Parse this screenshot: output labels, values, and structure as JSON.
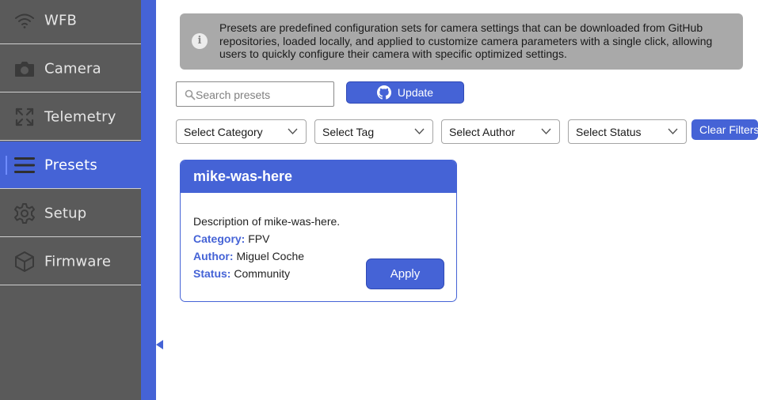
{
  "sidebar": {
    "items": [
      {
        "label": "WFB",
        "icon": "wifi-icon",
        "active": false
      },
      {
        "label": "Camera",
        "icon": "camera-icon",
        "active": false
      },
      {
        "label": "Telemetry",
        "icon": "expand-arrows-icon",
        "active": false
      },
      {
        "label": "Presets",
        "icon": "menu-lines-icon",
        "active": true
      },
      {
        "label": "Setup",
        "icon": "gear-icon",
        "active": false
      },
      {
        "label": "Firmware",
        "icon": "cube-icon",
        "active": false
      }
    ]
  },
  "info": {
    "icon": "info-icon",
    "text": "Presets are predefined configuration sets for camera settings that can be downloaded from GitHub repositories, loaded locally, and applied to customize camera parameters with a single click, allowing users to quickly configure their camera with specific optimized settings."
  },
  "toolbar": {
    "search_placeholder": "Search presets",
    "search_value": "",
    "update_label": "Update",
    "update_icon": "github-icon"
  },
  "filters": {
    "category": "Select Category",
    "tag": "Select Tag",
    "author": "Select Author",
    "status": "Select Status",
    "clear_label": "Clear Filters"
  },
  "presets": [
    {
      "title": "mike-was-here",
      "description": "Description of mike-was-here.",
      "category_key": "Category:",
      "category": "FPV",
      "author_key": "Author:",
      "author": "Miguel Coche",
      "status_key": "Status:",
      "status": "Community",
      "apply_label": "Apply"
    }
  ],
  "colors": {
    "accent": "#4563d6",
    "sidebar_bg": "#5a5a5a",
    "banner_bg": "#a9a9a9"
  }
}
